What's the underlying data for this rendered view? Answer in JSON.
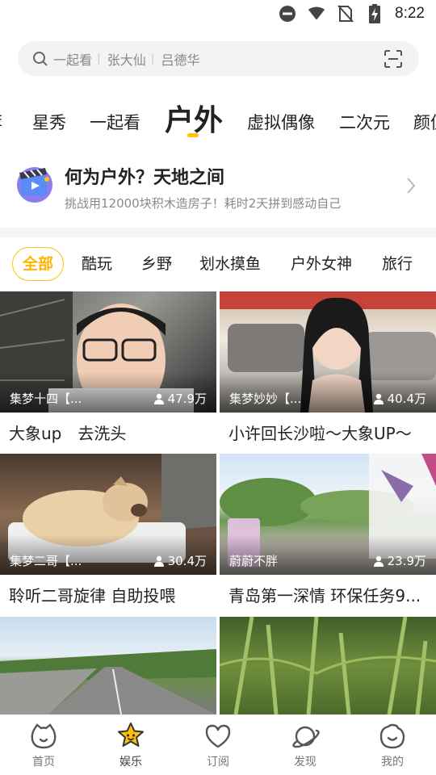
{
  "status_bar": {
    "time": "8:22"
  },
  "search": {
    "placeholder_items": [
      "一起看",
      "张大仙",
      "吕德华"
    ]
  },
  "top_tabs": [
    {
      "label": "荐"
    },
    {
      "label": "星秀"
    },
    {
      "label": "一起看"
    },
    {
      "label": "户外",
      "active": true
    },
    {
      "label": "虚拟偶像"
    },
    {
      "label": "二次元"
    },
    {
      "label": "颜值"
    }
  ],
  "banner": {
    "title": "何为户外？天地之间",
    "subtitle": "挑战用12000块积木造房子！耗时2天拼到感动自己"
  },
  "filters": [
    {
      "label": "全部",
      "active": true
    },
    {
      "label": "酷玩"
    },
    {
      "label": "乡野"
    },
    {
      "label": "划水摸鱼"
    },
    {
      "label": "户外女神"
    },
    {
      "label": "旅行"
    }
  ],
  "cards": [
    {
      "anchor": "集梦十四【...",
      "views": "47.9万",
      "title": "大象up　去洗头"
    },
    {
      "anchor": "集梦妙妙【...",
      "views": "40.4万",
      "title": "小许回长沙啦～大象UP～"
    },
    {
      "anchor": "集梦二哥【...",
      "views": "30.4万",
      "title": "聆听二哥旋律 自助投喂"
    },
    {
      "anchor": "蔚蔚不胖",
      "views": "23.9万",
      "title": "青岛第一深情 环保任务9..."
    },
    {
      "anchor": "",
      "views": "",
      "title": ""
    },
    {
      "anchor": "",
      "views": "",
      "title": ""
    }
  ],
  "bottom_nav": [
    {
      "label": "首页",
      "icon": "home-face-icon"
    },
    {
      "label": "娱乐",
      "icon": "star-face-icon",
      "active": true
    },
    {
      "label": "订阅",
      "icon": "heart-icon"
    },
    {
      "label": "发现",
      "icon": "planet-icon"
    },
    {
      "label": "我的",
      "icon": "smile-face-icon"
    }
  ],
  "colors": {
    "accent": "#ffc107",
    "accent_text": "#ffb300"
  }
}
